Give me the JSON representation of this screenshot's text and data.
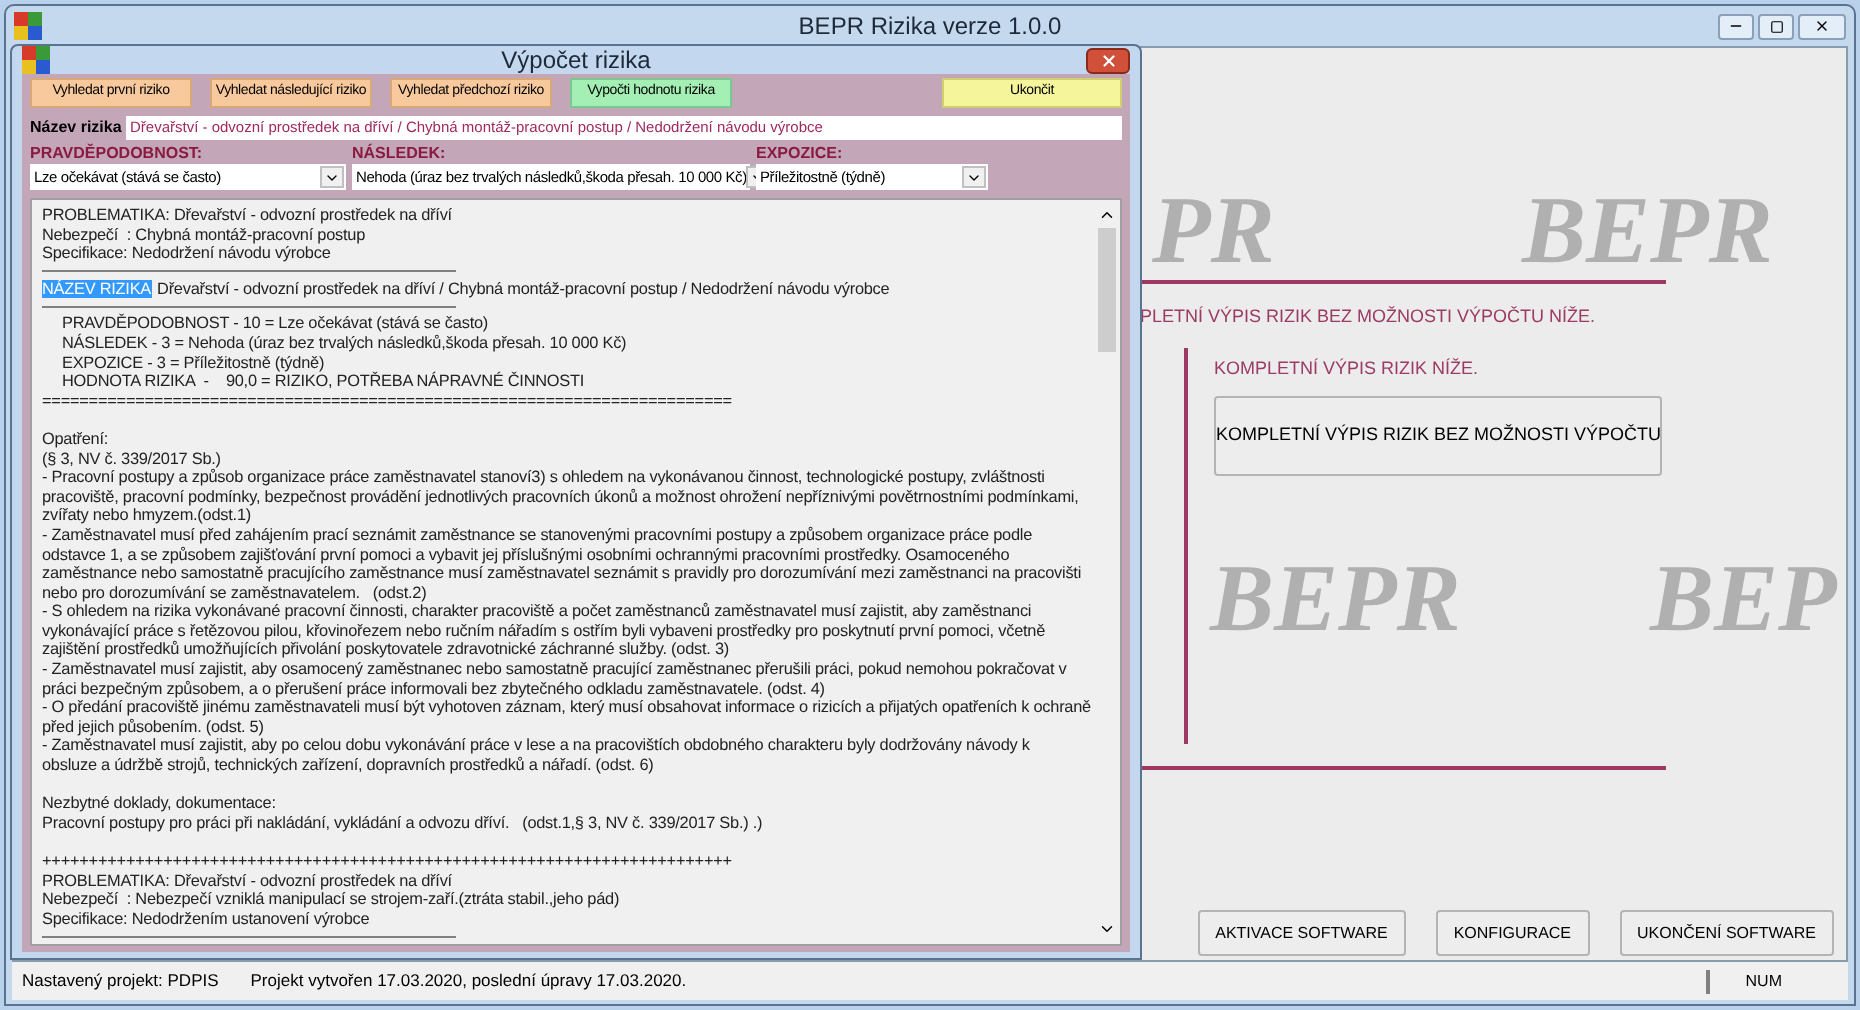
{
  "window": {
    "title": "BEPR Rizika verze 1.0.0"
  },
  "dialog": {
    "title": "Výpočet rizika",
    "buttons": [
      {
        "label": "Vyhledat první riziko",
        "kind": "search"
      },
      {
        "label": "Vyhledat následující riziko",
        "kind": "search"
      },
      {
        "label": "Vyhledat předchozí riziko",
        "kind": "search"
      },
      {
        "label": "Vypočti hodnotu rizika",
        "kind": "compute"
      },
      {
        "label": "Ukončit",
        "kind": "exit"
      }
    ],
    "name_field": {
      "label": "Název rizika",
      "value": "Dřevařství - odvozní prostředek na dříví / Chybná montáž-pracovní postup / Nedodržení návodu výrobce"
    },
    "selects": [
      {
        "label": "PRAVDĚPODOBNOST:",
        "value": "Lze očekávat (stává se často)"
      },
      {
        "label": "NÁSLEDEK:",
        "value": "Nehoda (úraz bez trvalých následků,škoda přesah. 10 000 Kč)"
      },
      {
        "label": "EXPOZICE:",
        "value": "Příležitostně (týdně)"
      }
    ],
    "report": {
      "lines": [
        {
          "kind": "text",
          "text": "PROBLEMATIKA: Dřevařství - odvozní prostředek na dříví"
        },
        {
          "kind": "text",
          "text": "Nebezpečí  : Chybná montáž-pracovní postup"
        },
        {
          "kind": "text",
          "text": "Specifikace: Nedodržení návodu výrobce"
        },
        {
          "kind": "rule"
        },
        {
          "kind": "title",
          "label": "NÁZEV RIZIKA",
          "selected": true,
          "text": "Dřevařství - odvozní prostředek na dříví / Chybná montáž-pracovní postup / Nedodržení návodu výrobce"
        },
        {
          "kind": "rule"
        },
        {
          "kind": "indent",
          "text": "PRAVDĚPODOBNOST - 10 = Lze očekávat (stává se často)"
        },
        {
          "kind": "indent",
          "text": "NÁSLEDEK - 3 = Nehoda (úraz bez trvalých následků,škoda přesah. 10 000 Kč)"
        },
        {
          "kind": "indent",
          "text": "EXPOZICE - 3 = Příležitostně (týdně)"
        },
        {
          "kind": "indent",
          "text": "HODNOTA RIZIKA  -    90,0 = RIZIKO, POTŘEBA NÁPRAVNÉ ČINNOSTI"
        },
        {
          "kind": "text",
          "text": "=========================================================================="
        },
        {
          "kind": "blank"
        },
        {
          "kind": "text",
          "text": "Opatření:"
        },
        {
          "kind": "text",
          "text": "(§ 3, NV č. 339/2017 Sb.)"
        },
        {
          "kind": "text",
          "text": "- Pracovní postupy a způsob organizace práce zaměstnavatel stanoví3) s ohledem na vykonávanou činnost, technologické postupy, zvláštnosti"
        },
        {
          "kind": "text",
          "text": "pracoviště, pracovní podmínky, bezpečnost provádění jednotlivých pracovních úkonů a možnost ohrožení nepříznivými povětrnostními podmínkami,"
        },
        {
          "kind": "text",
          "text": "zvířaty nebo hmyzem.(odst.1)"
        },
        {
          "kind": "text",
          "text": "- Zaměstnavatel musí před zahájením prací seznámit zaměstnance se stanovenými pracovními postupy a způsobem organizace práce podle"
        },
        {
          "kind": "text",
          "text": "odstavce 1, a se způsobem zajišťování první pomoci a vybavit jej příslušnými osobními ochrannými pracovními prostředky. Osamoceného"
        },
        {
          "kind": "text",
          "text": "zaměstnance nebo samostatně pracujícího zaměstnance musí zaměstnavatel seznámit s pravidly pro dorozumívání mezi zaměstnanci na pracovišti"
        },
        {
          "kind": "text",
          "text": "nebo pro dorozumívání se zaměstnavatelem.   (odst.2)"
        },
        {
          "kind": "text",
          "text": "- S ohledem na rizika vykonávané pracovní činnosti, charakter pracoviště a počet zaměstnanců zaměstnavatel musí zajistit, aby zaměstnanci"
        },
        {
          "kind": "text",
          "text": "vykonávající práce s řetězovou pilou, křovinořezem nebo ručním nářadím s ostřím byli vybaveni prostředky pro poskytnutí první pomoci, včetně"
        },
        {
          "kind": "text",
          "text": "zajištění prostředků umožňujících přivolání poskytovatele zdravotnické záchranné služby. (odst. 3)"
        },
        {
          "kind": "text",
          "text": "- Zaměstnavatel musí zajistit, aby osamocený zaměstnanec nebo samostatně pracující zaměstnanec přerušili práci, pokud nemohou pokračovat v"
        },
        {
          "kind": "text",
          "text": "práci bezpečným způsobem, a o přerušení práce informovali bez zbytečného odkladu zaměstnavatele. (odst. 4)"
        },
        {
          "kind": "text",
          "text": "- O předání pracoviště jinému zaměstnavateli musí být vyhotoven záznam, který musí obsahovat informace o rizicích a přijatých opatřeních k ochraně"
        },
        {
          "kind": "text",
          "text": "před jejich působením. (odst. 5)"
        },
        {
          "kind": "text",
          "text": "- Zaměstnavatel musí zajistit, aby po celou dobu vykonávání práce v lese a na pracovištích obdobného charakteru byly dodržovány návody k"
        },
        {
          "kind": "text",
          "text": "obsluze a údržbě strojů, technických zařízení, dopravních prostředků a nářadí. (odst. 6)"
        },
        {
          "kind": "blank"
        },
        {
          "kind": "text",
          "text": "Nezbytné doklady, dokumentace:"
        },
        {
          "kind": "text",
          "text": "Pracovní postupy pro práci při nakládání, vykládání a odvozu dříví.   (odst.1,§ 3, NV č. 339/2017 Sb.) .)"
        },
        {
          "kind": "blank"
        },
        {
          "kind": "text",
          "text": "++++++++++++++++++++++++++++++++++++++++++++++++++++++++++++++++++++++++++"
        },
        {
          "kind": "text",
          "text": "PROBLEMATIKA: Dřevařství - odvozní prostředek na dříví"
        },
        {
          "kind": "text",
          "text": "Nebezpečí  : Nebezpečí vzniklá manipulací se strojem-zaří.(ztráta stabil.,jeho pád)"
        },
        {
          "kind": "text",
          "text": "Specifikace: Nedodržením ustanovení výrobce"
        },
        {
          "kind": "rule"
        }
      ]
    }
  },
  "main": {
    "background_logos": [
      "PR",
      "BEPR",
      "BEPR",
      "BEP"
    ],
    "section_heading": "PLETNÍ VÝPIS RIZIK BEZ MOŽNOSTI VÝPOČTU NÍŽE.",
    "subsection_heading": "KOMPLETNÍ VÝPIS RIZIK NÍŽE.",
    "list_button": "KOMPLETNÍ VÝPIS RIZIK BEZ MOŽNOSTI VÝPOČTU",
    "footer_buttons": [
      "AKTIVACE SOFTWARE",
      "KONFIGURACE",
      "UKONČENÍ SOFTWARE"
    ]
  },
  "status_bar": {
    "project": "Nastavený projekt: PDPIS",
    "created": "Projekt vytvořen 17.03.2020, poslední úpravy 17.03.2020.",
    "num": "NUM"
  }
}
